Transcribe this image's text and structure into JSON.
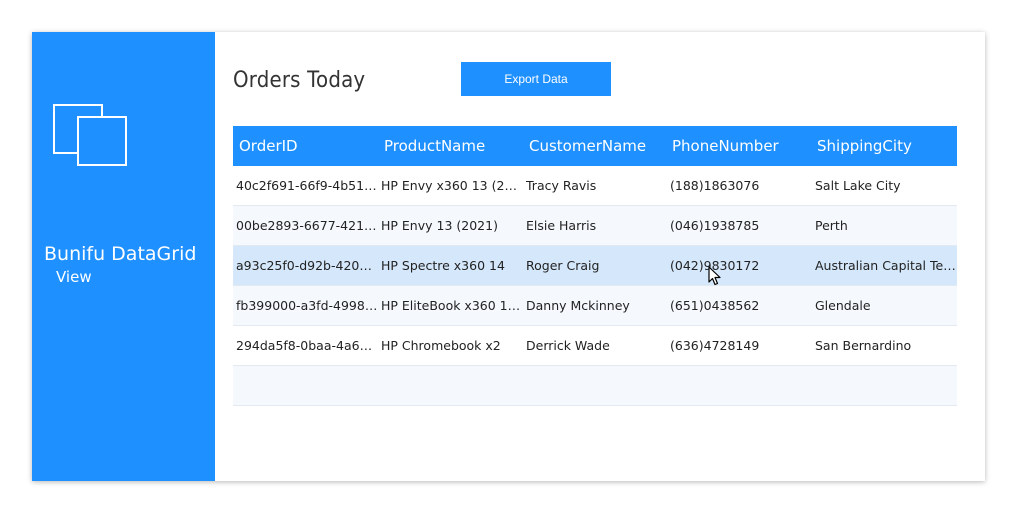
{
  "sidebar": {
    "brand_line1": "Bunifu DataGrid",
    "brand_line2": "View",
    "logo_icon": "overlapping-squares-icon",
    "color": "#1e90ff"
  },
  "main": {
    "title": "Orders Today",
    "export_label": "Export Data"
  },
  "grid": {
    "columns": [
      "OrderID",
      "ProductName",
      "CustomerName",
      "PhoneNumber",
      "ShippingCity"
    ],
    "rows": [
      [
        "40c2f691-66f9-4b51-b...",
        "HP Envy x360 13 (202...",
        "Tracy Ravis",
        "(188)1863076",
        "Salt Lake City"
      ],
      [
        "00be2893-6677-421e-...",
        "HP Envy 13 (2021)",
        "Elsie Harris",
        "(046)1938785",
        "Perth"
      ],
      [
        "a93c25f0-d92b-4207-...",
        "HP Spectre x360 14",
        "Roger Craig",
        "(042)9830172",
        "Australian Capital Ter..."
      ],
      [
        "fb399000-a3fd-4998-...",
        "HP EliteBook x360 10...",
        "Danny Mckinney",
        "(651)0438562",
        "Glendale"
      ],
      [
        "294da5f8-0baa-4a63-...",
        "HP Chromebook x2",
        "Derrick Wade",
        "(636)4728149",
        "San Bernardino"
      ]
    ],
    "selected_row": 3,
    "header_color": "#1e90ff",
    "selected_color": "#d4e7fb"
  },
  "cursor_icon": "mouse-pointer-icon"
}
